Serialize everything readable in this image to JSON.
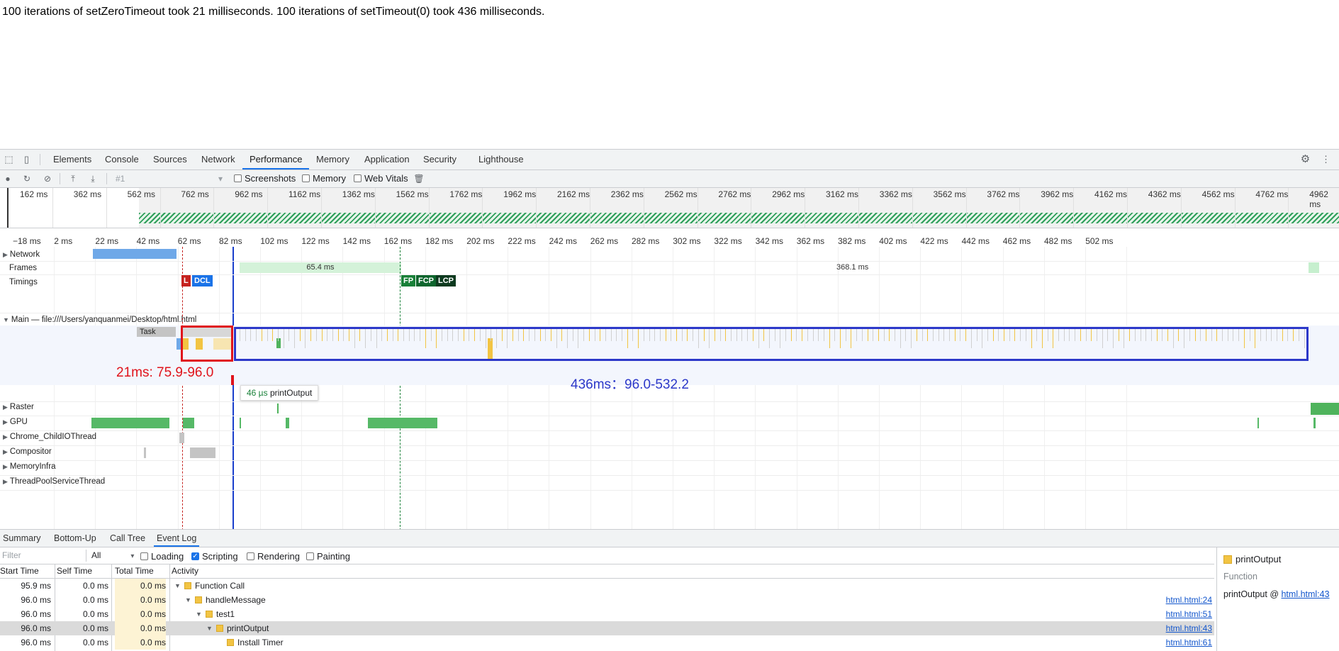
{
  "page": {
    "text": "100 iterations of setZeroTimeout took 21 milliseconds. 100 iterations of setTimeout(0) took 436 milliseconds."
  },
  "devtools": {
    "tabs": [
      "Elements",
      "Console",
      "Sources",
      "Network",
      "Performance",
      "Memory",
      "Application",
      "Security",
      "Lighthouse"
    ],
    "active_tab": "Performance",
    "toolbar": {
      "recording_select": "#1",
      "screenshots_label": "Screenshots",
      "memory_label": "Memory",
      "web_vitals_label": "Web Vitals"
    },
    "overview_ticks": [
      "162 ms",
      "362 ms",
      "562 ms",
      "762 ms",
      "962 ms",
      "1162 ms",
      "1362 ms",
      "1562 ms",
      "1762 ms",
      "1962 ms",
      "2162 ms",
      "2362 ms",
      "2562 ms",
      "2762 ms",
      "2962 ms",
      "3162 ms",
      "3362 ms",
      "3562 ms",
      "3762 ms",
      "3962 ms",
      "4162 ms",
      "4362 ms",
      "4562 ms",
      "4762 ms",
      "4962 ms"
    ],
    "ruler_ticks": [
      "−18 ms",
      "2 ms",
      "22 ms",
      "42 ms",
      "62 ms",
      "82 ms",
      "102 ms",
      "122 ms",
      "142 ms",
      "162 ms",
      "182 ms",
      "202 ms",
      "222 ms",
      "242 ms",
      "262 ms",
      "282 ms",
      "302 ms",
      "322 ms",
      "342 ms",
      "362 ms",
      "382 ms",
      "402 ms",
      "422 ms",
      "442 ms",
      "462 ms",
      "482 ms",
      "502 ms"
    ],
    "tracks": {
      "network": "Network",
      "frames": "Frames",
      "timings": "Timings",
      "main": "Main — file:///Users/yanquanmei/Desktop/html.html",
      "raster": "Raster",
      "gpu": "GPU",
      "io_thread": "Chrome_ChildIOThread",
      "compositor": "Compositor",
      "memory_infra": "MemoryInfra",
      "thread_pool": "ThreadPoolServiceThread"
    },
    "frames": {
      "frame1": "65.4 ms",
      "frame2": "368.1 ms"
    },
    "timing_markers": {
      "l": "L",
      "dcl": "DCL",
      "fp": "FP",
      "fcp": "FCP",
      "lcp": "LCP",
      "l_color": "#c5221f",
      "dcl_color": "#1a73e8",
      "fp_color": "#188038",
      "fcp_color": "#0d652d",
      "lcp_color": "#0d3a1f"
    },
    "task_label": "Task",
    "tooltip": {
      "duration": "46 µs",
      "name": "printOutput"
    },
    "annotations": {
      "red_label": "21ms: 75.9-96.0",
      "blue_label": "436ms：96.0-532.2",
      "red_color": "#e0131b",
      "blue_color": "#2c38c9"
    },
    "bottom": {
      "tabs": [
        "Summary",
        "Bottom-Up",
        "Call Tree",
        "Event Log"
      ],
      "active_tab": "Event Log",
      "filter_placeholder": "Filter",
      "duration_select": "All",
      "checkboxes": [
        {
          "label": "Loading",
          "checked": false
        },
        {
          "label": "Scripting",
          "checked": true
        },
        {
          "label": "Rendering",
          "checked": false
        },
        {
          "label": "Painting",
          "checked": false
        }
      ],
      "columns": [
        "Start Time",
        "Self Time",
        "Total Time",
        "Activity"
      ],
      "rows": [
        {
          "start": "95.9 ms",
          "self": "0.0 ms",
          "total": "0.0 ms",
          "activity": "Function Call",
          "link": ""
        },
        {
          "start": "96.0 ms",
          "self": "0.0 ms",
          "total": "0.0 ms",
          "activity": "handleMessage",
          "link": "html.html:24"
        },
        {
          "start": "96.0 ms",
          "self": "0.0 ms",
          "total": "0.0 ms",
          "activity": "test1",
          "link": "html.html:51"
        },
        {
          "start": "96.0 ms",
          "self": "0.0 ms",
          "total": "0.0 ms",
          "activity": "printOutput",
          "link": "html.html:43"
        },
        {
          "start": "96.0 ms",
          "self": "0.0 ms",
          "total": "0.0 ms",
          "activity": "Install Timer",
          "link": "html.html:61"
        }
      ],
      "details": {
        "title": "printOutput",
        "type": "Function",
        "source_prefix": "printOutput @ ",
        "source_link": "html.html:43"
      }
    }
  }
}
